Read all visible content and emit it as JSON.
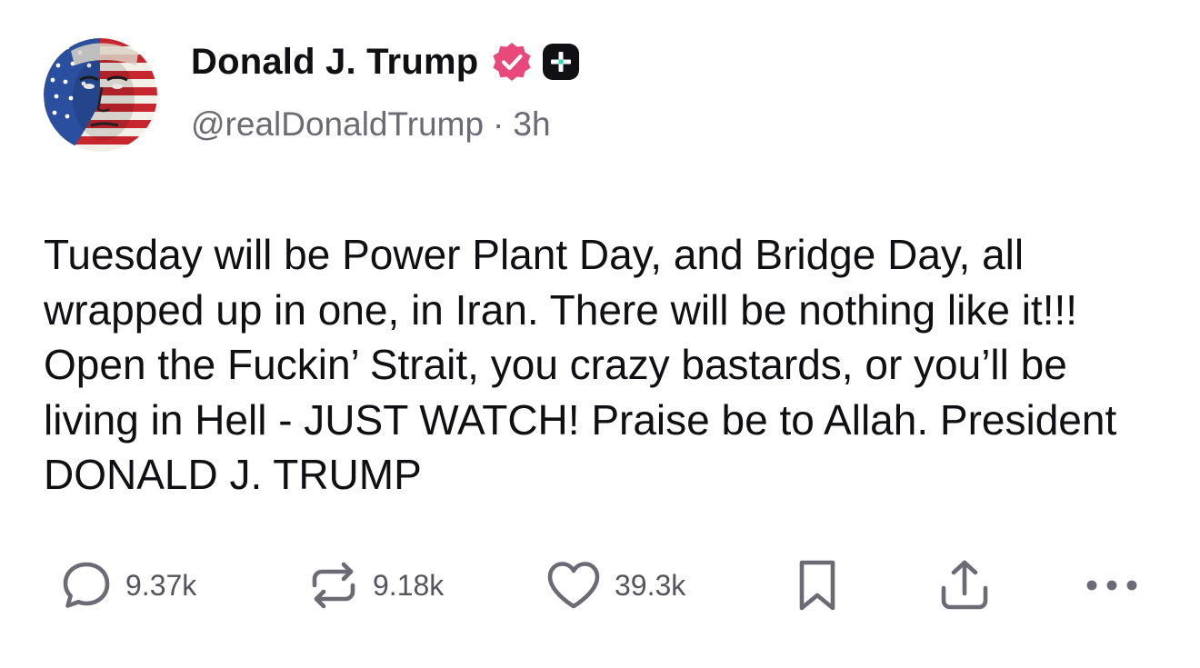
{
  "author": {
    "display_name": "Donald J. Trump",
    "handle": "@realDonaldTrump",
    "separator": "·",
    "time_ago": "3h",
    "verified_color": "#e8487a",
    "avatar_icon": "flag-portrait-avatar"
  },
  "post": {
    "text": "Tuesday will be Power Plant Day, and Bridge Day, all wrapped up in one, in Iran. There will be nothing like it!!! Open the Fuckin’ Strait, you crazy bastards, or you’ll be living in Hell - JUST WATCH! Praise be to Allah. President DONALD J. TRUMP"
  },
  "actions": {
    "reply": {
      "icon": "reply-bubble-icon",
      "count": "9.37k"
    },
    "repost": {
      "icon": "repost-icon",
      "count": "9.18k"
    },
    "like": {
      "icon": "heart-icon",
      "count": "39.3k"
    },
    "bookmark": {
      "icon": "bookmark-icon"
    },
    "share": {
      "icon": "share-upload-icon"
    },
    "more": {
      "icon": "more-dots-icon"
    }
  },
  "colors": {
    "text": "#0f0f14",
    "muted": "#6b6a75",
    "icon": "#6b6a75",
    "background": "#ffffff"
  }
}
